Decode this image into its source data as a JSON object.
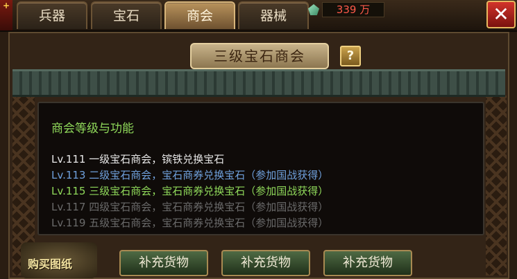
{
  "tabs": [
    {
      "label": "兵器",
      "active": false
    },
    {
      "label": "宝石",
      "active": false
    },
    {
      "label": "商会",
      "active": true
    },
    {
      "label": "器械",
      "active": false
    }
  ],
  "currency": {
    "icon": "gem-icon",
    "amount": "339 万",
    "color": "#ff5a4a"
  },
  "close_icon": "close-icon",
  "banner": {
    "title": "三级宝石商会",
    "help_label": "?"
  },
  "info_panel": {
    "title": "商会等级与功能",
    "rows": [
      {
        "text": "Lv.111  一级宝石商会，镔铁兑换宝石",
        "color": "#e8e8e8"
      },
      {
        "text": "Lv.113  二级宝石商会，宝石商券兑换宝石（参加国战获得）",
        "color": "#6fa0dc"
      },
      {
        "text": "Lv.115  三级宝石商会，宝石商券兑换宝石（参加国战获得）",
        "color": "#8fd85a"
      },
      {
        "text": "Lv.117  四级宝石商会，宝石商券兑换宝石（参加国战获得）",
        "color": "#6a6a6a"
      },
      {
        "text": "Lv.119  五级宝石商会，宝石商券兑换宝石（参加国战获得）",
        "color": "#6a6a6a"
      }
    ]
  },
  "buy_scroll": {
    "label": "购买图纸"
  },
  "actions": [
    {
      "label": "补充货物"
    },
    {
      "label": "补充货物"
    },
    {
      "label": "补充货物"
    }
  ]
}
